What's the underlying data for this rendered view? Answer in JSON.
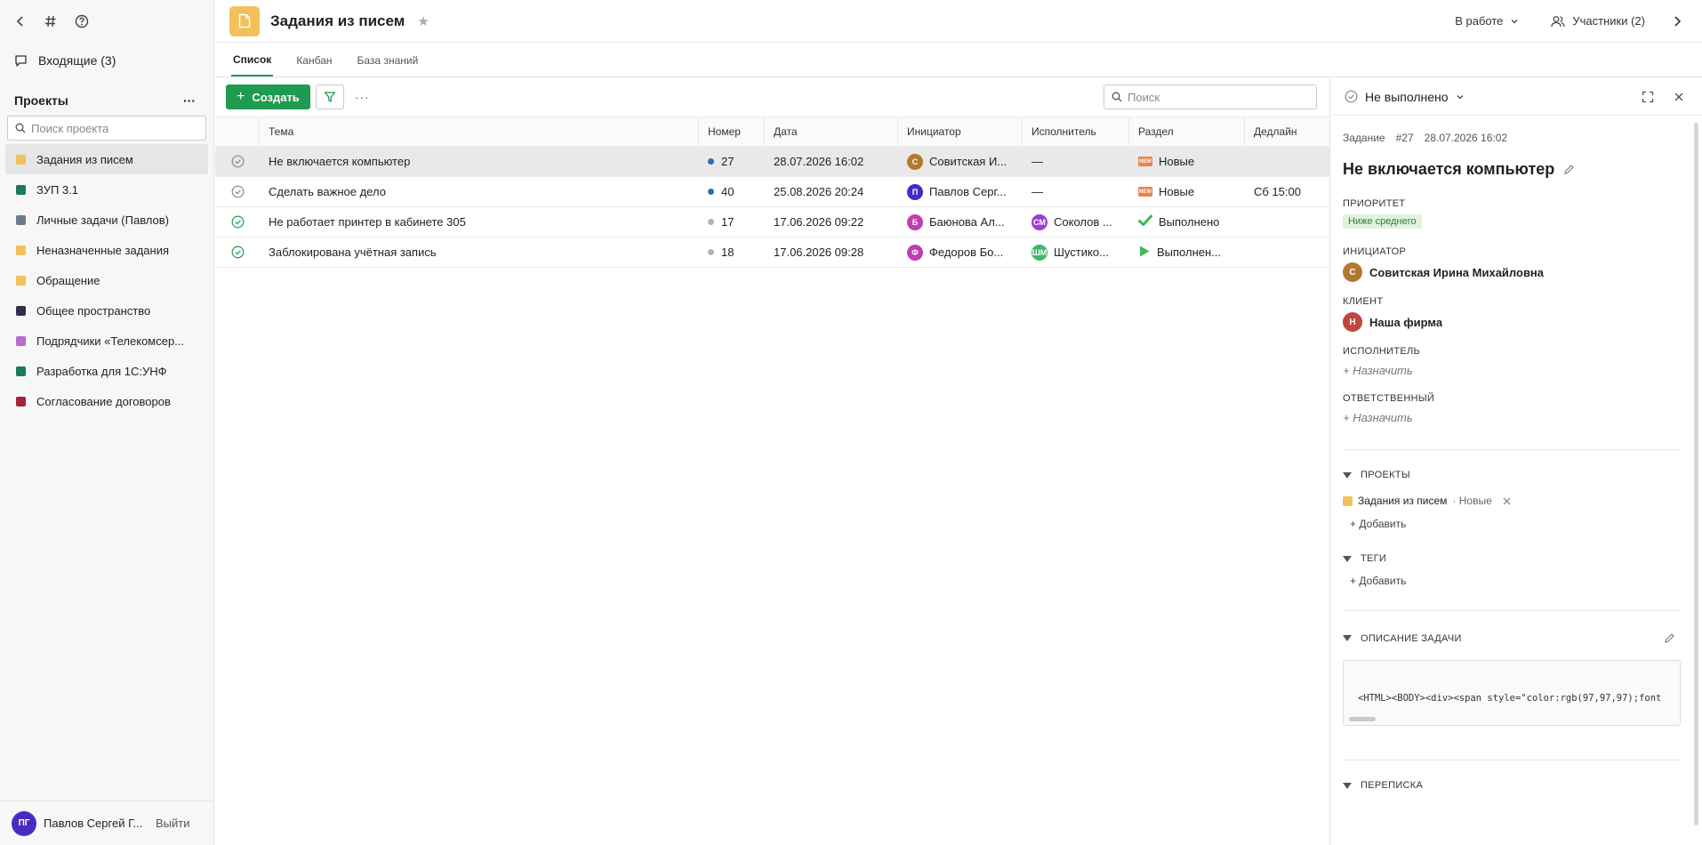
{
  "sidebar": {
    "inbox": "Входящие (3)",
    "projects_title": "Проекты",
    "projects_more": "···",
    "search_placeholder": "Поиск проекта",
    "projects": [
      {
        "name": "Задания из писем",
        "color": "#f2c15b",
        "active": true
      },
      {
        "name": "ЗУП 3.1",
        "color": "#1a7a60"
      },
      {
        "name": "Личные задачи (Павлов)",
        "color": "#6f7a8c"
      },
      {
        "name": "Неназначенные задания",
        "color": "#f2c15b"
      },
      {
        "name": "Обращение",
        "color": "#f2c15b"
      },
      {
        "name": "Общее пространство",
        "color": "#2f3050"
      },
      {
        "name": "Подрядчики «Телекомсер...",
        "color": "#b86ad1"
      },
      {
        "name": "Разработка для 1С:УНФ",
        "color": "#1a7a60"
      },
      {
        "name": "Согласование договоров",
        "color": "#a3263b"
      }
    ],
    "user": {
      "initials": "ПГ",
      "name": "Павлов Сергей Г...",
      "color": "#4a2bc2"
    },
    "logout": "Выйти"
  },
  "header": {
    "title": "Задания из писем",
    "status": "В работе",
    "members": "Участники (2)"
  },
  "tabs": [
    "Список",
    "Канбан",
    "База знаний"
  ],
  "toolbar": {
    "create_label": "Создать",
    "search_placeholder": "Поиск"
  },
  "table": {
    "columns": [
      "Тема",
      "Номер",
      "Дата",
      "Инициатор",
      "Исполнитель",
      "Раздел",
      "Дедлайн"
    ],
    "rows": [
      {
        "done": false,
        "subject": "Не включается компьютер",
        "num": "27",
        "num_color": "#2f6db5",
        "date": "28.07.2026 16:02",
        "init_initial": "С",
        "init_color": "#b07a2e",
        "initiator": "Совитская И...",
        "exec_initial": "",
        "exec_color": "",
        "executor": "—",
        "section_icon": "new",
        "section": "Новые",
        "deadline": ""
      },
      {
        "done": false,
        "subject": "Сделать важное дело",
        "num": "40",
        "num_color": "#2f6db5",
        "date": "25.08.2026 20:24",
        "init_initial": "П",
        "init_color": "#4a2bc2",
        "initiator": "Павлов Серг...",
        "exec_initial": "",
        "exec_color": "",
        "executor": "—",
        "section_icon": "new",
        "section": "Новые",
        "deadline": "Сб 15:00"
      },
      {
        "done": true,
        "subject": "Не работает принтер в кабинете 305",
        "num": "17",
        "num_color": "#a8b4c4",
        "date": "17.06.2026 09:22",
        "init_initial": "Б",
        "init_color": "#c03fb0",
        "initiator": "Баюнова Ал...",
        "exec_initial": "СМ",
        "exec_color": "#9a3fd1",
        "executor": "Соколов ...",
        "section_icon": "check",
        "section": "Выполнено",
        "deadline": ""
      },
      {
        "done": true,
        "subject": "Заблокирована учётная запись",
        "num": "18",
        "num_color": "#a8b4c4",
        "date": "17.06.2026 09:28",
        "init_initial": "Ф",
        "init_color": "#c03fb0",
        "initiator": "Федоров Бо...",
        "exec_initial": "ШМ",
        "exec_color": "#3fb86a",
        "executor": "Шустико...",
        "section_icon": "play",
        "section": "Выполнен...",
        "deadline": ""
      }
    ]
  },
  "panel": {
    "state": "Не выполнено",
    "meta_type": "Задание",
    "meta_num": "#27",
    "meta_date": "28.07.2026 16:02",
    "title": "Не включается компьютер",
    "priority_label": "ПРИОРИТЕТ",
    "priority": "Ниже среднего",
    "initiator_label": "ИНИЦИАТОР",
    "initiator_initial": "С",
    "initiator": "Совитская Ирина Михайловна",
    "client_label": "КЛИЕНТ",
    "client_initial": "Н",
    "client": "Наша фирма",
    "executor_label": "ИСПОЛНИТЕЛЬ",
    "assign": "+ Назначить",
    "responsible_label": "ОТВЕТСТВЕННЫЙ",
    "projects_label": "ПРОЕКТЫ",
    "project_tag": "Задания из писем",
    "project_section": "· Новые",
    "add": "+ Добавить",
    "tags_label": "ТЕГИ",
    "description_label": "ОПИСАНИЕ ЗАДАЧИ",
    "description_code": "<HTML><BODY><div><span style=\"color:rgb(97,97,97);font",
    "correspondence_label": "ПЕРЕПИСКА"
  }
}
